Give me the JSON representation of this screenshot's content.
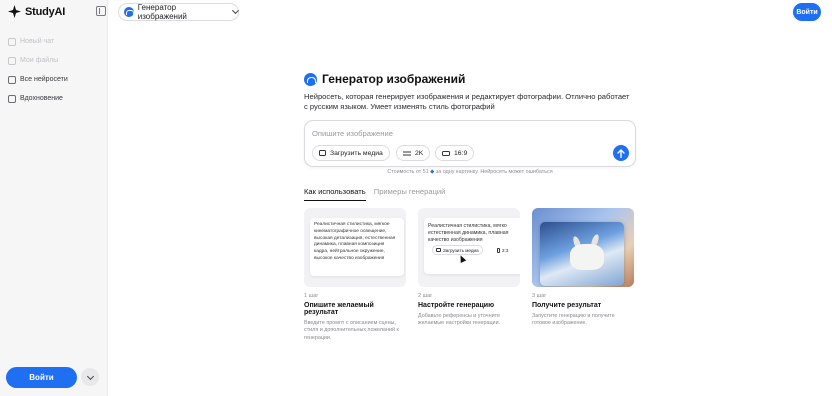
{
  "brand": {
    "name": "StudyAI"
  },
  "sidebar": {
    "items": [
      {
        "label": "Новый чат",
        "state": "disabled"
      },
      {
        "label": "Мои файлы",
        "state": "disabled"
      },
      {
        "label": "Все нейросети",
        "state": "active"
      },
      {
        "label": "Вдохновение",
        "state": "active"
      }
    ],
    "login_label": "Войти"
  },
  "topbar": {
    "model_label": "Генератор изображений",
    "login_label": "Войти"
  },
  "main": {
    "title": "Генератор изображений",
    "description": "Нейросеть, которая генерирует изображения и редактирует фотографии. Отлично работает с русским языком. Умеет изменять стиль фотографий",
    "prompt": {
      "placeholder": "Опишите изображение",
      "value": "",
      "upload_label": "Загрузить медиа",
      "quality_label": "2K",
      "ratio_label": "16:9"
    },
    "cost_prefix": "Стоимость от 51",
    "cost_suffix": "за одну картинку. Нейросеть может ошибаться",
    "tabs": [
      {
        "label": "Как использовать",
        "active": true
      },
      {
        "label": "Примеры генераций",
        "active": false
      }
    ],
    "steps": [
      {
        "num": "1 шаг",
        "title": "Опишите желаемый результат",
        "desc": "Введите промпт с описанием сцены, стиля и дополнительных пожеланий к генерации.",
        "card_text": "Реалистичная стилистика, мягкое кинематографичное освещение, высокая детализация, естественная динамика, плавная композиция кадра, нейтральное окружение, высокое качество изображения"
      },
      {
        "num": "2 шаг",
        "title": "Настройте генерацию",
        "desc": "Добавьте референсы и уточните желаемые настройки генерации.",
        "card_text": "Реалистичная стилистика, мягко естественная динамика, плавная качество изображения",
        "mini_upload": "Загрузить медиа",
        "mini_ratio": "2:3"
      },
      {
        "num": "3 шаг",
        "title": "Получите результат",
        "desc": "Запустите генерацию и получите готовое изображение."
      }
    ]
  },
  "colors": {
    "accent": "#1f6ff2",
    "sidebar_bg": "#f6f6f7"
  }
}
